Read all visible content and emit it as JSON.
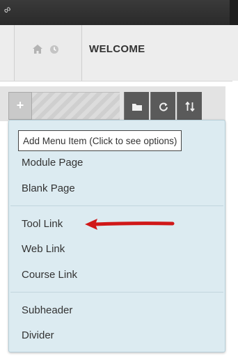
{
  "header": {
    "title": "WELCOME",
    "icons": [
      "link-icon",
      "home-icon",
      "clock-icon"
    ]
  },
  "toolbar": {
    "add_symbol": "+",
    "buttons": [
      {
        "icon": "folder-icon",
        "glyph": "▬"
      },
      {
        "icon": "refresh-icon",
        "glyph": "C"
      },
      {
        "icon": "sort-icon",
        "glyph": "↑↓"
      }
    ]
  },
  "tooltip": {
    "text": "Add Menu Item (Click to see options)"
  },
  "menu": {
    "items": [
      "Module Page",
      "Blank Page",
      "Tool Link",
      "Web Link",
      "Course Link",
      "Subheader",
      "Divider"
    ]
  },
  "colors": {
    "topbar": "#2e2e2e",
    "menu_bg": "#dcebf1",
    "arrow": "#d01818"
  }
}
